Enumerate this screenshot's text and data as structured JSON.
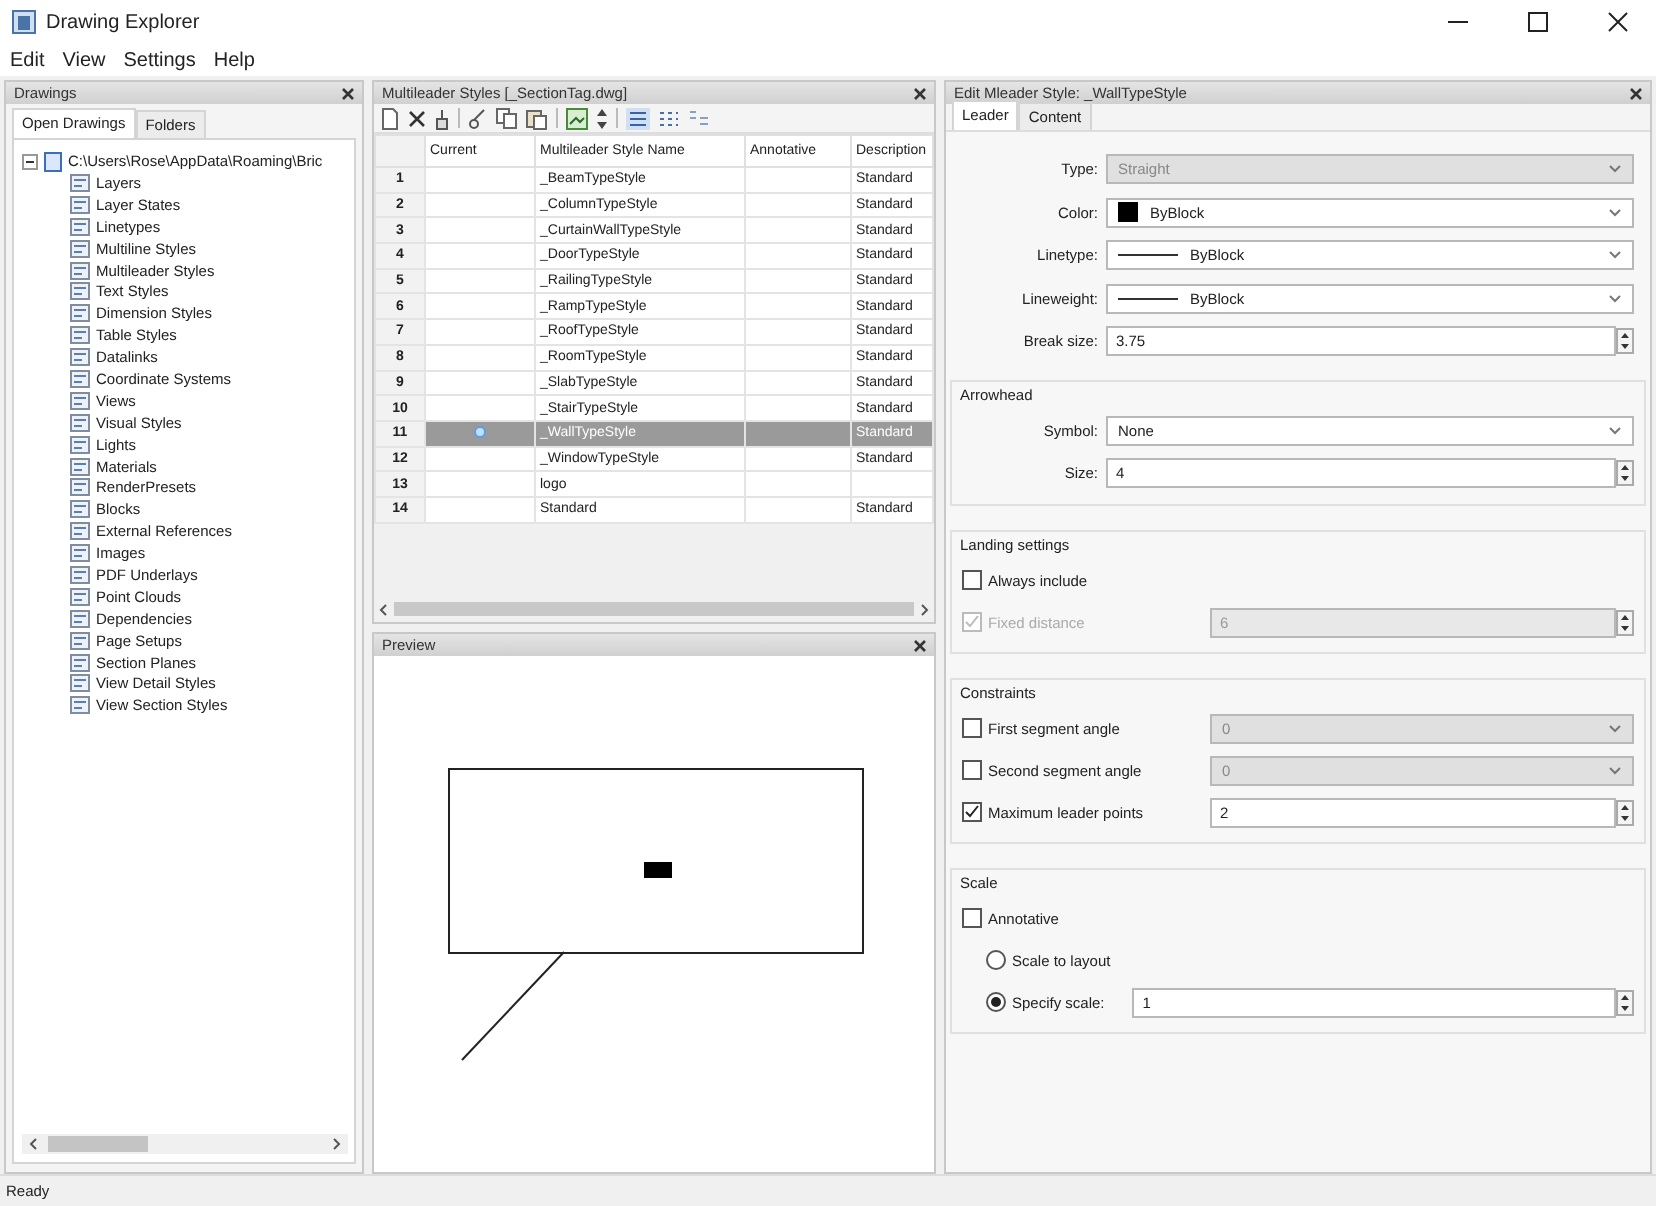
{
  "window": {
    "title": "Drawing Explorer"
  },
  "menu": [
    "Edit",
    "View",
    "Settings",
    "Help"
  ],
  "drawings_panel": {
    "title": "Drawings",
    "tabs": [
      {
        "label": "Open Drawings",
        "selected": true
      },
      {
        "label": "Folders",
        "selected": false
      }
    ],
    "tree": {
      "label": "C:\\Users\\Rose\\AppData\\Roaming\\Bric",
      "expanded": true,
      "children": [
        {
          "label": "Layers"
        },
        {
          "label": "Layer States"
        },
        {
          "label": "Linetypes"
        },
        {
          "label": "Multiline Styles"
        },
        {
          "label": "Multileader Styles"
        },
        {
          "label": "Text Styles"
        },
        {
          "label": "Dimension Styles"
        },
        {
          "label": "Table Styles"
        },
        {
          "label": "Datalinks"
        },
        {
          "label": "Coordinate Systems"
        },
        {
          "label": "Views"
        },
        {
          "label": "Visual Styles"
        },
        {
          "label": "Lights"
        },
        {
          "label": "Materials"
        },
        {
          "label": "RenderPresets"
        },
        {
          "label": "Blocks"
        },
        {
          "label": "External References"
        },
        {
          "label": "Images"
        },
        {
          "label": "PDF Underlays"
        },
        {
          "label": "Point Clouds"
        },
        {
          "label": "Dependencies"
        },
        {
          "label": "Page Setups"
        },
        {
          "label": "Section Planes"
        },
        {
          "label": "View Detail Styles"
        },
        {
          "label": "View Section Styles"
        }
      ]
    }
  },
  "styles_panel": {
    "title": "Multileader Styles [_SectionTag.dwg]",
    "columns": [
      "Current",
      "Multileader Style Name",
      "Annotative",
      "Description"
    ],
    "rows": [
      {
        "number": "1",
        "current": false,
        "name": "_BeamTypeStyle",
        "description": "Standard",
        "selected": false
      },
      {
        "number": "2",
        "current": false,
        "name": "_ColumnTypeStyle",
        "description": "Standard",
        "selected": false
      },
      {
        "number": "3",
        "current": false,
        "name": "_CurtainWallTypeStyle",
        "description": "Standard",
        "selected": false
      },
      {
        "number": "4",
        "current": false,
        "name": "_DoorTypeStyle",
        "description": "Standard",
        "selected": false
      },
      {
        "number": "5",
        "current": false,
        "name": "_RailingTypeStyle",
        "description": "Standard",
        "selected": false
      },
      {
        "number": "6",
        "current": false,
        "name": "_RampTypeStyle",
        "description": "Standard",
        "selected": false
      },
      {
        "number": "7",
        "current": false,
        "name": "_RoofTypeStyle",
        "description": "Standard",
        "selected": false
      },
      {
        "number": "8",
        "current": false,
        "name": "_RoomTypeStyle",
        "description": "Standard",
        "selected": false
      },
      {
        "number": "9",
        "current": false,
        "name": "_SlabTypeStyle",
        "description": "Standard",
        "selected": false
      },
      {
        "number": "10",
        "current": false,
        "name": "_StairTypeStyle",
        "description": "Standard",
        "selected": false
      },
      {
        "number": "11",
        "current": true,
        "name": "_WallTypeStyle",
        "description": "Standard",
        "selected": true
      },
      {
        "number": "12",
        "current": false,
        "name": "_WindowTypeStyle",
        "description": "Standard",
        "selected": false
      },
      {
        "number": "13",
        "current": false,
        "name": "logo",
        "selected": false
      },
      {
        "number": "14",
        "current": false,
        "name": "Standard",
        "description": "Standard",
        "selected": false
      }
    ]
  },
  "preview_panel": {
    "title": "Preview"
  },
  "editor": {
    "title": "Edit Mleader Style: _WallTypeStyle",
    "tabs": [
      {
        "label": "Leader",
        "selected": true
      },
      {
        "label": "Content",
        "selected": false
      }
    ],
    "fields": [
      {
        "kind": "dropdown",
        "label": "Type:",
        "value": "Straight",
        "disabled": true
      },
      {
        "kind": "color",
        "label": "Color:",
        "value": "ByBlock",
        "color": "#000000"
      },
      {
        "kind": "line",
        "label": "Linetype:",
        "value": "ByBlock"
      },
      {
        "kind": "line",
        "label": "Lineweight:",
        "value": "ByBlock"
      },
      {
        "kind": "spin",
        "label": "Break size:",
        "value": "3.75"
      }
    ],
    "groups": [
      {
        "title": "Arrowhead",
        "items": [
          {
            "kind": "dropdown",
            "label": "Symbol:",
            "value": "None"
          },
          {
            "kind": "spin",
            "label": "Size:",
            "value": "4"
          }
        ]
      },
      {
        "title": "Landing settings",
        "items": [
          {
            "kind": "check",
            "label": "Always include",
            "checked": false,
            "disabled": false
          },
          {
            "kind": "check",
            "label": "Fixed distance",
            "checked": true,
            "disabled": true,
            "control": {
              "kind": "spin",
              "value": "6",
              "disabled": true
            }
          }
        ]
      },
      {
        "title": "Constraints",
        "items": [
          {
            "kind": "check",
            "label": "First segment angle",
            "checked": false,
            "disabled": false,
            "control": {
              "kind": "dropdown",
              "value": "0",
              "disabled": true
            }
          },
          {
            "kind": "check",
            "label": "Second segment angle",
            "checked": false,
            "disabled": false,
            "control": {
              "kind": "dropdown",
              "value": "0",
              "disabled": true
            }
          },
          {
            "kind": "check",
            "label": "Maximum leader points",
            "checked": true,
            "disabled": false,
            "control": {
              "kind": "spin",
              "value": "2",
              "disabled": false
            }
          }
        ]
      },
      {
        "title": "Scale",
        "items": [
          {
            "kind": "check",
            "label": "Annotative",
            "checked": false,
            "disabled": false
          },
          {
            "kind": "radio",
            "label": "Scale to layout",
            "selected": false
          },
          {
            "kind": "radio",
            "label": "Specify scale:",
            "selected": true,
            "control": {
              "kind": "spin",
              "value": "1",
              "disabled": false
            }
          }
        ]
      }
    ]
  },
  "status_bar": "Ready"
}
